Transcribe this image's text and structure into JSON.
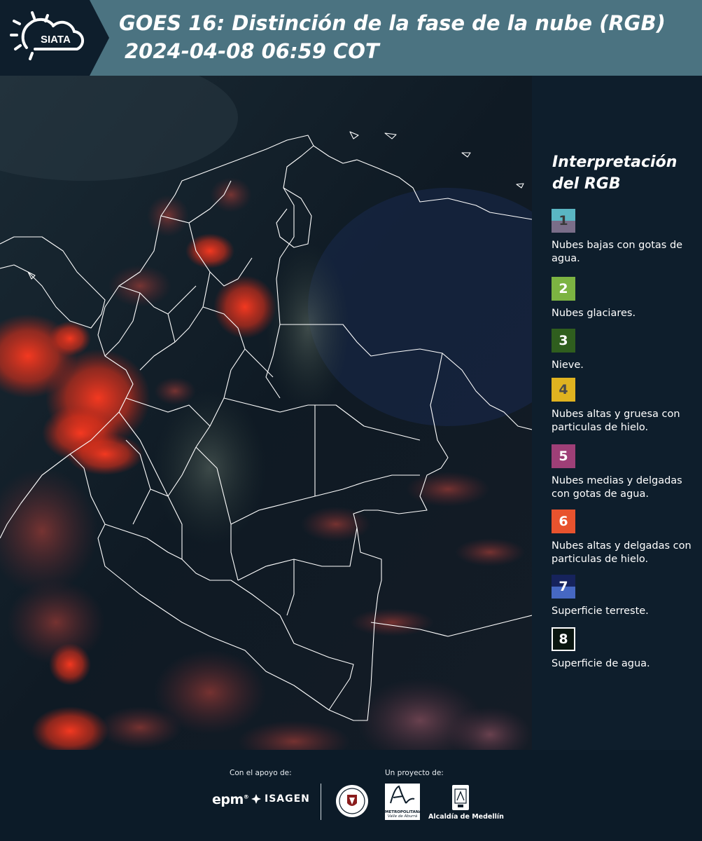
{
  "header": {
    "logo_text": "SIATA",
    "title_line1": "GOES 16: Distinción de la fase de la nube (RGB)",
    "title_line2": "2024-04-08 06:59 COT"
  },
  "legend": {
    "title_line1": "Interpretación",
    "title_line2": "del RGB",
    "items": [
      {
        "num": "1",
        "label": "Nubes bajas con gotas de agua.",
        "color_top": "#5ab6c3",
        "color_bottom": "#7a6e89",
        "num_color": "#3a3a3a"
      },
      {
        "num": "2",
        "label": "Nubes glaciares.",
        "color_top": "#7cb342",
        "color_bottom": "#7cb342",
        "num_color": "#ffffff"
      },
      {
        "num": "3",
        "label": "Nieve.",
        "color_top": "#2f5e1e",
        "color_bottom": "#2f5e1e",
        "num_color": "#ffffff"
      },
      {
        "num": "4",
        "label": "Nubes altas y gruesa con particulas de hielo.",
        "color_top": "#e0b320",
        "color_bottom": "#e0b320",
        "num_color": "#4a4a4a"
      },
      {
        "num": "5",
        "label": "Nubes medias y delgadas con gotas de agua.",
        "color_top": "#9e3f77",
        "color_bottom": "#9e3f77",
        "num_color": "#ffffff"
      },
      {
        "num": "6",
        "label": "Nubes altas y delgadas con particulas de hielo.",
        "color_top": "#e8532e",
        "color_bottom": "#e8532e",
        "num_color": "#ffffff"
      },
      {
        "num": "7",
        "label": "Superficie terreste.",
        "color_top": "#16235c",
        "color_bottom": "#4668c2",
        "num_color": "#ffffff"
      },
      {
        "num": "8",
        "label": "Superficie de agua.",
        "color_top": "#0a1610",
        "color_bottom": "#0a1610",
        "num_color": "#ffffff"
      }
    ]
  },
  "footer": {
    "support_label": "Con el apoyo de:",
    "project_label": "Un proyecto de:",
    "epm": "epm",
    "epm_mark": "®",
    "isagen": "ISAGEN",
    "metro_line1": "METROPOLITANA",
    "metro_line2": "Valle de Aburrá",
    "alcaldia": "Alcaldía de Medellín"
  },
  "colors": {
    "header_bg": "#4b7381",
    "logo_bg": "#0e1e2c",
    "legend_bg": "#0e1e2c",
    "cloud_red": "#ff3a20",
    "border_lines": "#ffffff"
  }
}
